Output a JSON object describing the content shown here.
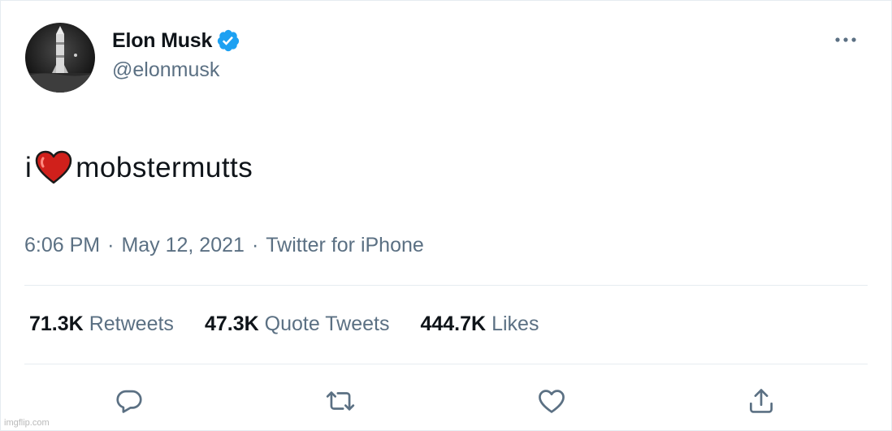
{
  "tweet": {
    "author": {
      "display_name": "Elon Musk",
      "handle": "@elonmusk",
      "verified": true,
      "avatar_icon": "rocket-avatar"
    },
    "text_before": "i",
    "emoji": "red-heart",
    "text_after": "mobstermutts",
    "meta": {
      "time": "6:06 PM",
      "date": "May 12, 2021",
      "source": "Twitter for iPhone",
      "separator": "·"
    },
    "stats": [
      {
        "count": "71.3K",
        "label": "Retweets"
      },
      {
        "count": "47.3K",
        "label": "Quote Tweets"
      },
      {
        "count": "444.7K",
        "label": "Likes"
      }
    ],
    "actions": [
      "reply-icon",
      "retweet-icon",
      "like-icon",
      "share-icon"
    ]
  },
  "watermark": "imgflip.com",
  "colors": {
    "text_primary": "#0f1419",
    "text_secondary": "#5b7083",
    "verified_blue": "#1da1f2",
    "divider": "#e6ecf0",
    "heart_red": "#e0245e"
  }
}
